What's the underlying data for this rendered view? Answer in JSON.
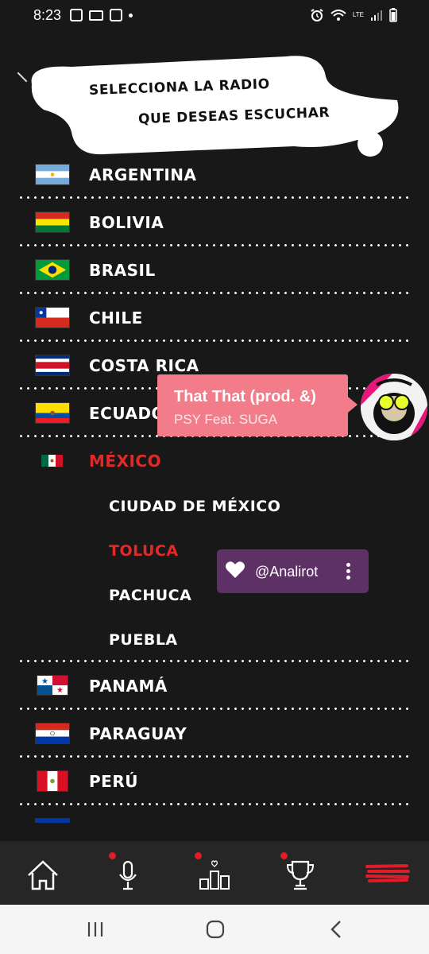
{
  "status_bar": {
    "time": "8:23",
    "network": "LTE"
  },
  "header": {
    "line1": "SELECCIONA LA RADIO",
    "line2": "QUE DESEAS ESCUCHAR"
  },
  "countries": [
    {
      "label": "ARGENTINA",
      "flag": "argentina"
    },
    {
      "label": "BOLIVIA",
      "flag": "bolivia"
    },
    {
      "label": "BRASIL",
      "flag": "brazil"
    },
    {
      "label": "CHILE",
      "flag": "chile"
    },
    {
      "label": "COSTA RICA",
      "flag": "costa-rica"
    },
    {
      "label": "ECUADOR",
      "flag": "ecuador"
    },
    {
      "label": "MÉXICO",
      "flag": "mexico",
      "active": true
    },
    {
      "label": "PANAMÁ",
      "flag": "panama"
    },
    {
      "label": "PARAGUAY",
      "flag": "paraguay"
    },
    {
      "label": "PERÚ",
      "flag": "peru"
    }
  ],
  "mexico_cities": [
    {
      "label": "CIUDAD DE MÉXICO"
    },
    {
      "label": "TOLUCA",
      "active": true
    },
    {
      "label": "PACHUCA"
    },
    {
      "label": "PUEBLA"
    }
  ],
  "now_playing": {
    "title": "That That (prod. &)",
    "artist": "PSY Feat. SUGA"
  },
  "dj": {
    "name": "@Analirot"
  },
  "colors": {
    "accent": "#e02a2a",
    "now_playing_bg": "#f27c8a",
    "dj_bg": "#5d3166",
    "background": "#181818"
  },
  "bottom_nav": [
    "home-icon",
    "microphone-icon",
    "ranking-icon",
    "trophy-icon",
    "menu-icon"
  ]
}
